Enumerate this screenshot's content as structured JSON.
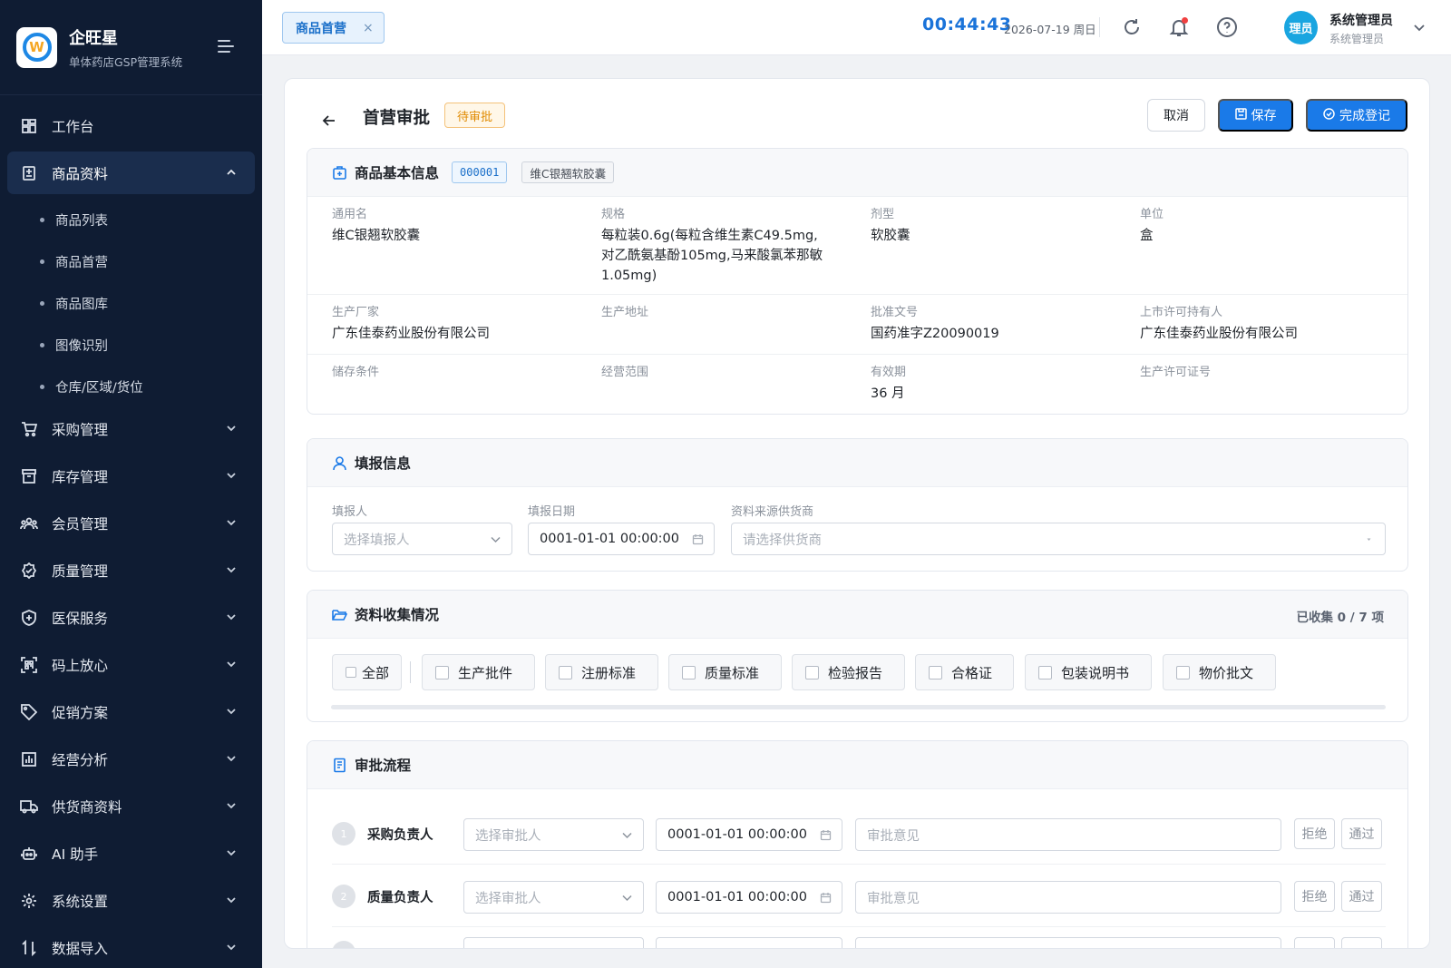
{
  "brand": {
    "name": "企旺星",
    "subtitle": "单体药店GSP管理系统",
    "logo_letter": "W"
  },
  "sidebar": {
    "items": [
      {
        "label": "工作台",
        "icon": "dashboard-icon"
      },
      {
        "label": "商品资料",
        "icon": "product-icon",
        "active": true,
        "expanded": true
      },
      {
        "label": "采购管理",
        "icon": "cart-icon"
      },
      {
        "label": "库存管理",
        "icon": "archive-icon"
      },
      {
        "label": "会员管理",
        "icon": "members-icon"
      },
      {
        "label": "质量管理",
        "icon": "quality-icon"
      },
      {
        "label": "医保服务",
        "icon": "shield-icon"
      },
      {
        "label": "码上放心",
        "icon": "scan-icon"
      },
      {
        "label": "促销方案",
        "icon": "tag-icon"
      },
      {
        "label": "经营分析",
        "icon": "chart-icon"
      },
      {
        "label": "供货商资料",
        "icon": "truck-icon"
      },
      {
        "label": "AI 助手",
        "icon": "robot-icon"
      },
      {
        "label": "系统设置",
        "icon": "gear-icon"
      },
      {
        "label": "数据导入",
        "icon": "import-icon"
      }
    ],
    "subitems": [
      "商品列表",
      "商品首营",
      "商品图库",
      "图像识别",
      "仓库/区域/货位"
    ]
  },
  "topbar": {
    "tab_label": "商品首营",
    "tab_close": "×",
    "clock": "00:44:43",
    "date": "2026-07-19 周日",
    "avatar_text": "理员",
    "user_name": "系统管理员",
    "user_role": "系统管理员"
  },
  "page": {
    "title": "首营审批",
    "status": "待审批",
    "cancel_label": "取消",
    "save_label": "保存",
    "complete_label": "完成登记"
  },
  "basic_info": {
    "title": "商品基本信息",
    "code": "000001",
    "name_tag": "维C银翘软胶囊",
    "fields": [
      {
        "label": "通用名",
        "value": "维C银翘软胶囊"
      },
      {
        "label": "规格",
        "value": "每粒装0.6g(每粒含维生素C49.5mg,对乙酰氨基酚105mg,马来酸氯苯那敏1.05mg)"
      },
      {
        "label": "剂型",
        "value": "软胶囊"
      },
      {
        "label": "单位",
        "value": "盒"
      },
      {
        "label": "生产厂家",
        "value": "广东佳泰药业股份有限公司"
      },
      {
        "label": "生产地址",
        "value": ""
      },
      {
        "label": "批准文号",
        "value": "国药准字Z20090019"
      },
      {
        "label": "上市许可持有人",
        "value": "广东佳泰药业股份有限公司"
      },
      {
        "label": "储存条件",
        "value": ""
      },
      {
        "label": "经营范围",
        "value": ""
      },
      {
        "label": "有效期",
        "value": "36 月"
      },
      {
        "label": "生产许可证号",
        "value": ""
      }
    ]
  },
  "report_info": {
    "title": "填报信息",
    "reporter_label": "填报人",
    "reporter_placeholder": "选择填报人",
    "date_label": "填报日期",
    "date_value": "0001-01-01 00:00:00",
    "supplier_label": "资料来源供货商",
    "supplier_placeholder": "请选择供货商"
  },
  "materials": {
    "title": "资料收集情况",
    "count_text": "已收集 0 / 7 项",
    "all_label": "全部",
    "items": [
      "生产批件",
      "注册标准",
      "质量标准",
      "检验报告",
      "合格证",
      "包装说明书",
      "物价批文"
    ]
  },
  "approval": {
    "title": "审批流程",
    "approver_placeholder": "选择审批人",
    "comment_placeholder": "审批意见",
    "reject_label": "拒绝",
    "pass_label": "通过",
    "steps": [
      {
        "num": "1",
        "role": "采购负责人",
        "date": "0001-01-01 00:00:00"
      },
      {
        "num": "2",
        "role": "质量负责人",
        "date": "0001-01-01 00:00:00"
      }
    ]
  }
}
